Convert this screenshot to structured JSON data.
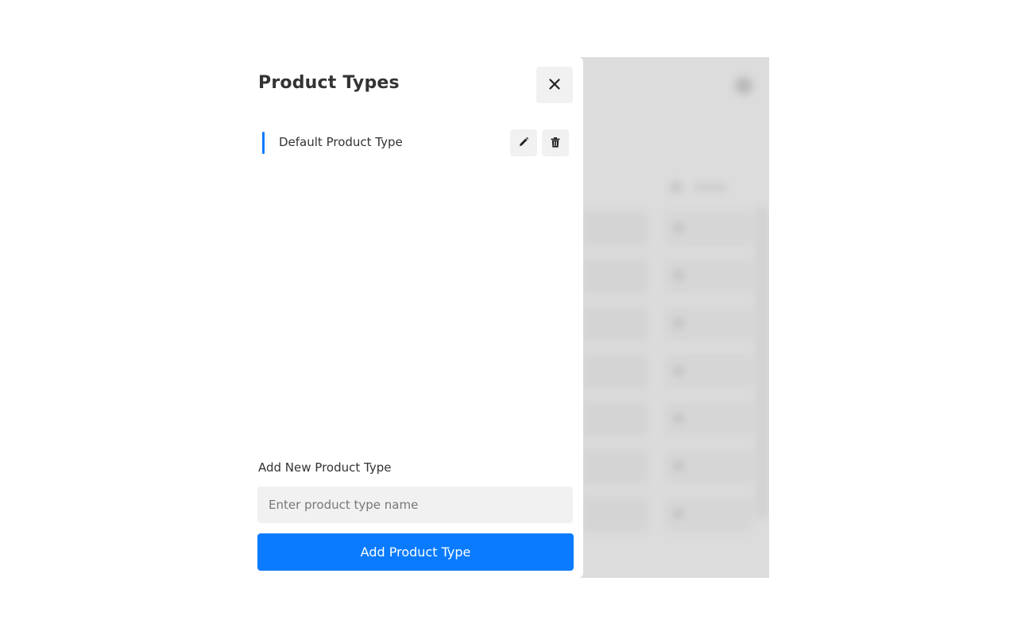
{
  "drawer": {
    "title": "Product Types",
    "close_icon": "close-icon"
  },
  "product_types": {
    "items": [
      {
        "label": "Default Product Type",
        "active": true,
        "edit_icon": "pencil-icon",
        "delete_icon": "trash-icon"
      }
    ]
  },
  "add_form": {
    "label": "Add New Product Type",
    "input_placeholder": "Enter product type name",
    "input_value": "",
    "button_label": "Add Product Type"
  },
  "colors": {
    "accent": "#0a7bff",
    "button_bg": "#f1f1f1",
    "text": "#333333",
    "overlay_bg": "#dcdcdc"
  }
}
